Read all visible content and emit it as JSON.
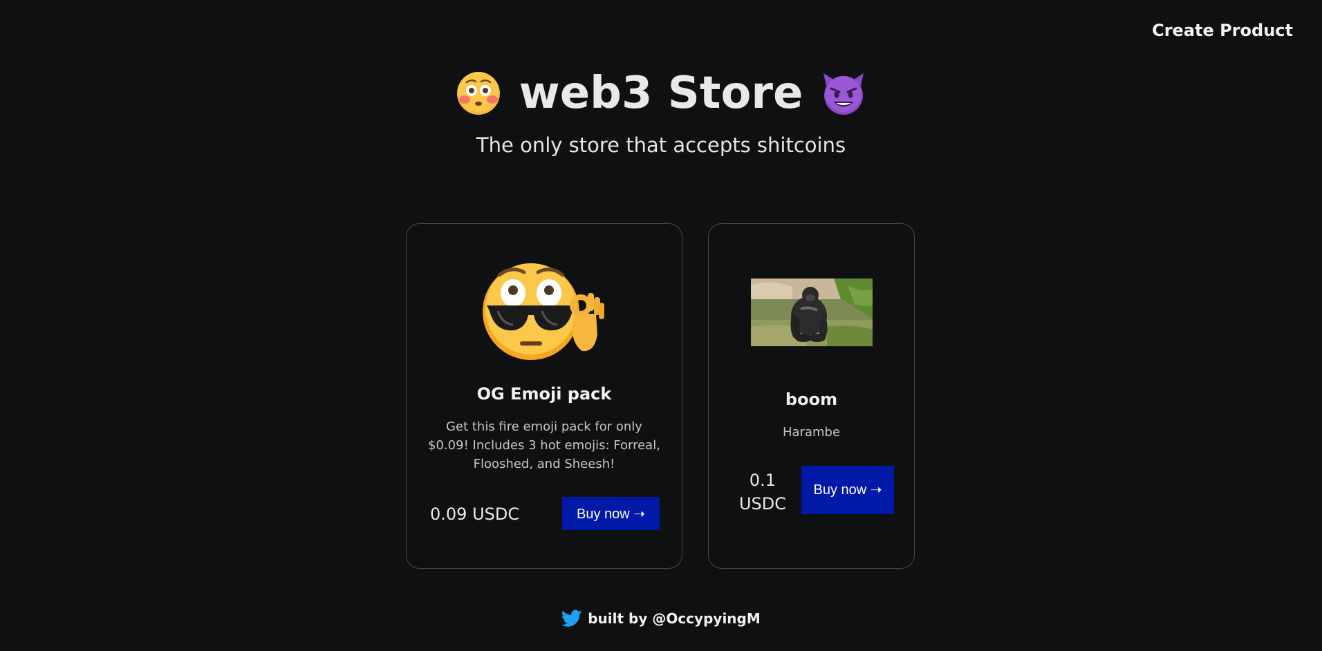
{
  "nav": {
    "create_product_label": "Create Product"
  },
  "header": {
    "title": "web3 Store",
    "subtitle": "The only store that accepts shitcoins",
    "left_icon": "flushed-face-icon",
    "right_icon": "smiling-devil-icon"
  },
  "products": [
    {
      "name": "OG Emoji pack",
      "description": "Get this fire emoji pack for only $0.09! Includes 3 hot emojis: Forreal, Flooshed, and Sheesh!",
      "price": "0.09 USDC",
      "buy_label": "Buy now ➝",
      "image_icon": "cool-face-ok-hand-icon"
    },
    {
      "name": "boom",
      "description": "Harambe",
      "price": "0.1 USDC",
      "buy_label": "Buy now ➝",
      "image_icon": "gorilla-photo"
    }
  ],
  "footer": {
    "text": "built by @OccypyingM",
    "icon": "twitter-icon"
  },
  "colors": {
    "background": "#0f1012",
    "button": "#0019a6",
    "card_border": "#4a4a46",
    "twitter_blue": "#1da1f2"
  }
}
